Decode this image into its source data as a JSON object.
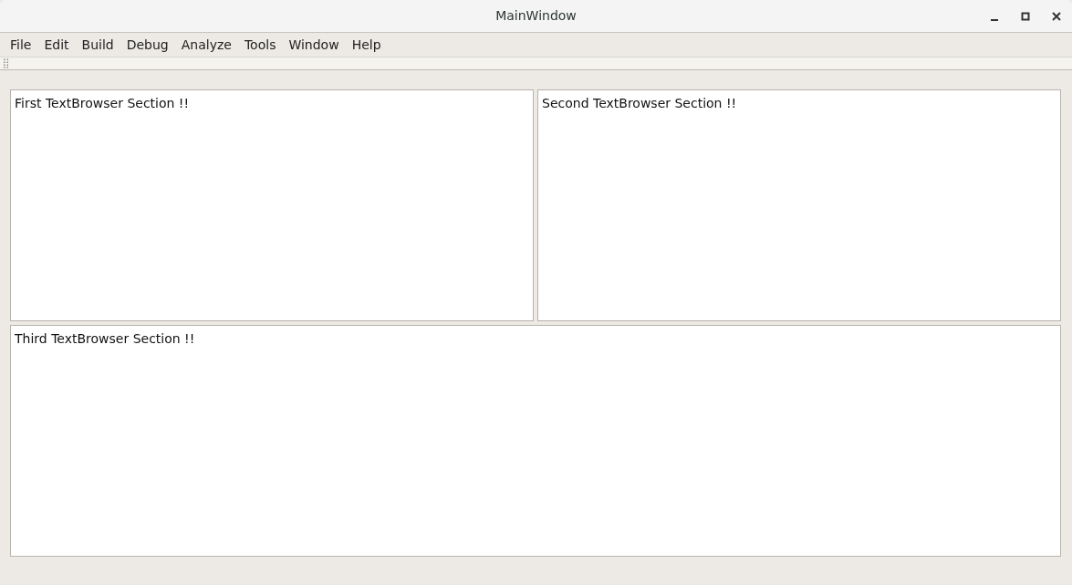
{
  "window": {
    "title": "MainWindow"
  },
  "menu": [
    {
      "label": "File"
    },
    {
      "label": "Edit"
    },
    {
      "label": "Build"
    },
    {
      "label": "Debug"
    },
    {
      "label": "Analyze"
    },
    {
      "label": "Tools"
    },
    {
      "label": "Window"
    },
    {
      "label": "Help"
    }
  ],
  "top_panes": [
    {
      "text": "First TextBrowser Section !!"
    },
    {
      "text": "Second TextBrowser Section !!"
    }
  ],
  "bottom_pane": {
    "text": "Third TextBrowser Section !!"
  }
}
